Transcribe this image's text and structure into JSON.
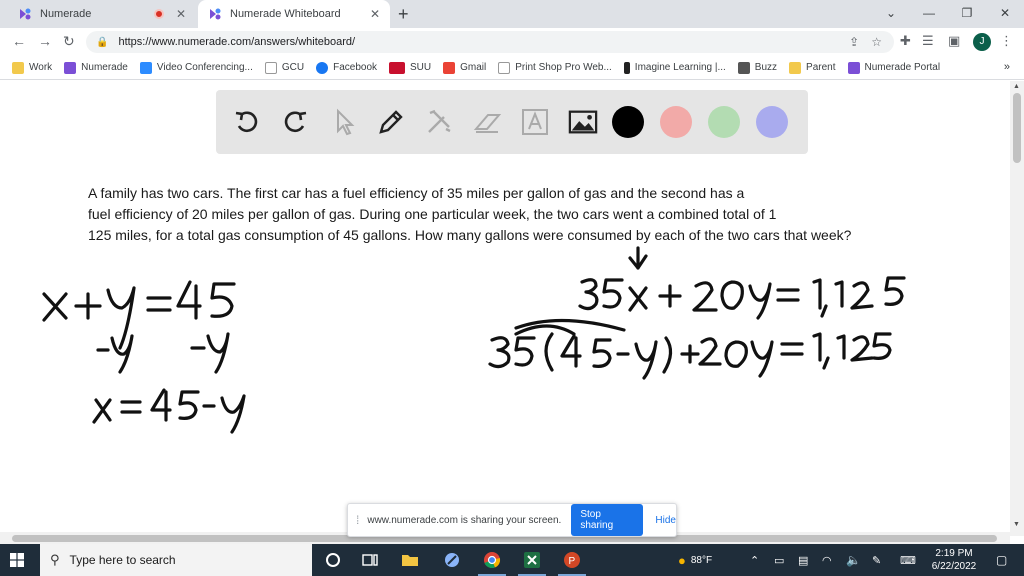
{
  "browser": {
    "tabs": [
      {
        "title": "Numerade",
        "state": "recording"
      },
      {
        "title": "Numerade Whiteboard",
        "state": "active"
      }
    ],
    "new_tab": "+",
    "window_controls": [
      "⌄",
      "—",
      "❐",
      "✕"
    ],
    "url": "https://www.numerade.com/answers/whiteboard/",
    "profile_initial": "J",
    "bookmarks": [
      {
        "label": "Work",
        "icon": "folder-icon"
      },
      {
        "label": "Numerade",
        "icon": "numerade-icon"
      },
      {
        "label": "Video Conferencing...",
        "icon": "video-icon"
      },
      {
        "label": "GCU",
        "icon": "page-icon"
      },
      {
        "label": "Facebook",
        "icon": "facebook-icon"
      },
      {
        "label": "SUU",
        "icon": "suu-icon"
      },
      {
        "label": "Gmail",
        "icon": "gmail-icon"
      },
      {
        "label": "Print Shop Pro Web...",
        "icon": "page-icon"
      },
      {
        "label": "Imagine Learning |...",
        "icon": "imagine-icon"
      },
      {
        "label": "Buzz",
        "icon": "buzz-icon"
      },
      {
        "label": "Parent",
        "icon": "folder-icon"
      },
      {
        "label": "Numerade Portal",
        "icon": "numerade-icon"
      }
    ],
    "bookmarks_more": "»"
  },
  "whiteboard": {
    "tools": [
      "undo-icon",
      "redo-icon",
      "pointer-icon",
      "pen-icon",
      "tools-icon",
      "eraser-icon",
      "text-icon",
      "image-icon"
    ],
    "colors": [
      "#000000",
      "#f2aaa8",
      "#b3dcb2",
      "#a9abee"
    ]
  },
  "problem": {
    "lines": [
      "A family has two cars. The first car has a fuel efficiency of 35 miles per gallon of gas and the second has a",
      "fuel efficiency of 20 miles per gallon of gas. During one particular week, the two cars went a combined total of 1",
      "125 miles, for a total gas consumption of 45 gallons. How many gallons were consumed by each of the two cars that week?"
    ]
  },
  "handwriting": {
    "eq1": "x+y = 45",
    "eq1_sub": "-y      -y",
    "eq2": "x = 45-y",
    "eq3": "35x + 20y = 1,125",
    "eq4": "35(45-y)+20y = 1,125"
  },
  "share_bar": {
    "message": "www.numerade.com is sharing your screen.",
    "stop": "Stop sharing",
    "hide": "Hide"
  },
  "taskbar": {
    "search_placeholder": "Type here to search",
    "weather": "88°F",
    "time": "2:19 PM",
    "date": "6/22/2022",
    "apps": [
      "cortana-icon",
      "task-view-icon",
      "file-explorer-icon",
      "snip-icon",
      "chrome-icon",
      "excel-icon",
      "powerpoint-icon"
    ]
  }
}
